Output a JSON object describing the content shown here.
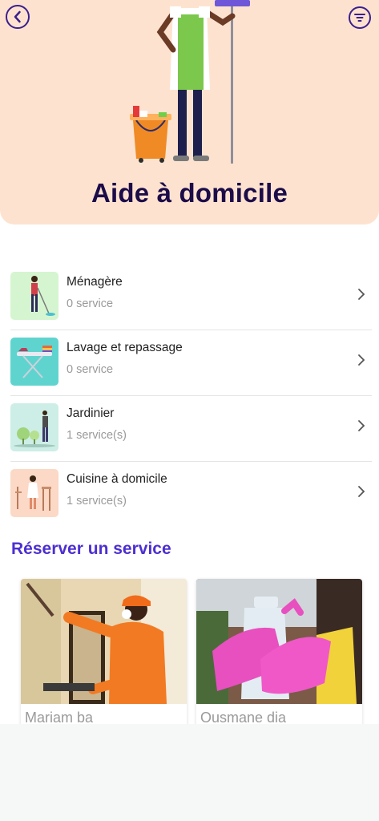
{
  "header": {
    "title": "Aide à domicile"
  },
  "categories": [
    {
      "name": "Ménagère",
      "count": "0 service"
    },
    {
      "name": "Lavage et repassage",
      "count": "0 service"
    },
    {
      "name": "Jardinier",
      "count": "1 service(s)"
    },
    {
      "name": "Cuisine à domicile",
      "count": "1 service(s)"
    }
  ],
  "booking": {
    "title": "Réserver un service",
    "providers": [
      {
        "name": "Mariam ba"
      },
      {
        "name": "Ousmane dia"
      }
    ]
  },
  "colors": {
    "accent": "#4d2fd0",
    "hero_bg": "#fde3cf",
    "title_dark": "#1c0c4a"
  }
}
